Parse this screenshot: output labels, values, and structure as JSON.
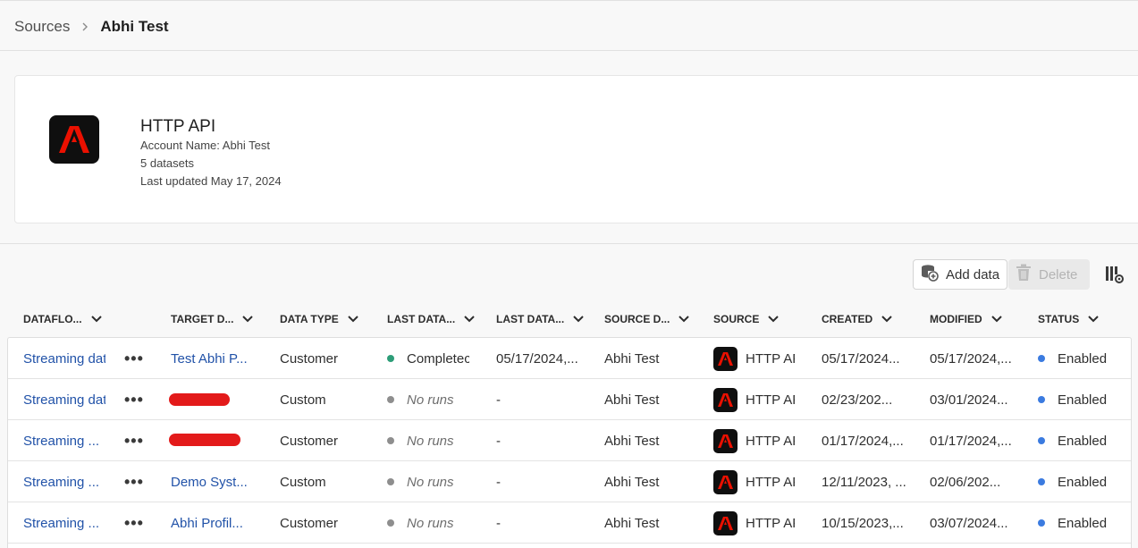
{
  "breadcrumb": {
    "parent": "Sources",
    "current": "Abhi Test"
  },
  "account": {
    "title": "HTTP API",
    "account_name": "Account Name: Abhi Test",
    "datasets": "5 datasets",
    "last_updated": "Last updated May 17, 2024"
  },
  "toolbar": {
    "add_label": "Add data",
    "delete_label": "Delete"
  },
  "columns": [
    "DATAFLO...",
    "TARGET D...",
    "DATA TYPE",
    "LAST DATA...",
    "LAST DATA...",
    "SOURCE D...",
    "SOURCE",
    "CREATED",
    "MODIFIED",
    "STATUS"
  ],
  "colors": {
    "completed_dot": "#2d9d78",
    "norun_dot": "#8e8e8e",
    "enabled_dot": "#3b7be0",
    "link": "#2152a8",
    "adobe_red": "#eb1000"
  },
  "rows": [
    {
      "dataflow": "Streaming dat",
      "target": "Test Abhi P...",
      "data_type": "Customer",
      "run_status": "Completec",
      "run_date": "05/17/2024,...",
      "source_dataset": "Abhi Test",
      "source": "HTTP AF",
      "created": "05/17/2024...",
      "modified": "05/17/2024,...",
      "status": "Enabled"
    },
    {
      "dataflow": "Streaming dat",
      "target": "",
      "data_type": "Custom",
      "run_status": "No runs",
      "run_date": "-",
      "source_dataset": "Abhi Test",
      "source": "HTTP AF",
      "created": "02/23/202...",
      "modified": "03/01/2024...",
      "status": "Enabled"
    },
    {
      "dataflow": "Streaming ...",
      "target": "",
      "data_type": "Customer",
      "run_status": "No runs",
      "run_date": "-",
      "source_dataset": "Abhi Test",
      "source": "HTTP AF",
      "created": "01/17/2024,...",
      "modified": "01/17/2024,...",
      "status": "Enabled"
    },
    {
      "dataflow": "Streaming ...",
      "target": "Demo Syst...",
      "data_type": "Custom",
      "run_status": "No runs",
      "run_date": "-",
      "source_dataset": "Abhi Test",
      "source": "HTTP AF",
      "created": "12/11/2023, ...",
      "modified": "02/06/202...",
      "status": "Enabled"
    },
    {
      "dataflow": "Streaming ...",
      "target": "Abhi Profil...",
      "data_type": "Customer",
      "run_status": "No runs",
      "run_date": "-",
      "source_dataset": "Abhi Test",
      "source": "HTTP AF",
      "created": "10/15/2023,...",
      "modified": "03/07/2024...",
      "status": "Enabled"
    }
  ]
}
